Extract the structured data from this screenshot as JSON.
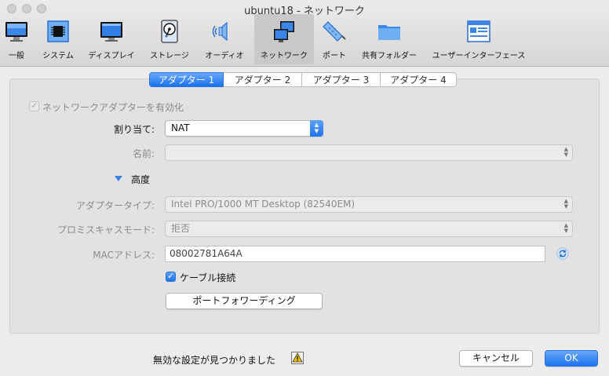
{
  "window": {
    "title": "ubuntu18 - ネットワーク"
  },
  "toolbar": {
    "items": [
      {
        "label": "一般",
        "icon": "monitor-icon"
      },
      {
        "label": "システム",
        "icon": "chip-icon"
      },
      {
        "label": "ディスプレイ",
        "icon": "display-icon"
      },
      {
        "label": "ストレージ",
        "icon": "disk-icon"
      },
      {
        "label": "オーディオ",
        "icon": "speaker-icon"
      },
      {
        "label": "ネットワーク",
        "icon": "network-icon",
        "active": true
      },
      {
        "label": "ポート",
        "icon": "port-icon"
      },
      {
        "label": "共有フォルダー",
        "icon": "folder-icon"
      },
      {
        "label": "ユーザーインターフェース",
        "icon": "ui-window-icon"
      }
    ]
  },
  "tabs": [
    "アダプター 1",
    "アダプター 2",
    "アダプター 3",
    "アダプター 4"
  ],
  "active_tab": 0,
  "form": {
    "enable_label": "ネットワークアダプターを有効化",
    "enable_checked": true,
    "attached_label": "割り当て:",
    "attached_value": "NAT",
    "name_label": "名前:",
    "name_value": "",
    "advanced_label": "高度",
    "adapter_type_label": "アダプタータイプ:",
    "adapter_type_value": "Intel PRO/1000 MT Desktop (82540EM)",
    "promisc_label": "プロミスキャスモード:",
    "promisc_value": "拒否",
    "mac_label": "MACアドレス:",
    "mac_value": "08002781A64A",
    "cable_label": "ケーブル接続",
    "cable_checked": true,
    "port_forwarding_label": "ポートフォワーディング"
  },
  "footer": {
    "message": "無効な設定が見つかりました",
    "cancel_label": "キャンセル",
    "ok_label": "OK"
  },
  "colors": {
    "accent": "#1f74ef",
    "selected_toolbar": "#c9c9c9"
  }
}
